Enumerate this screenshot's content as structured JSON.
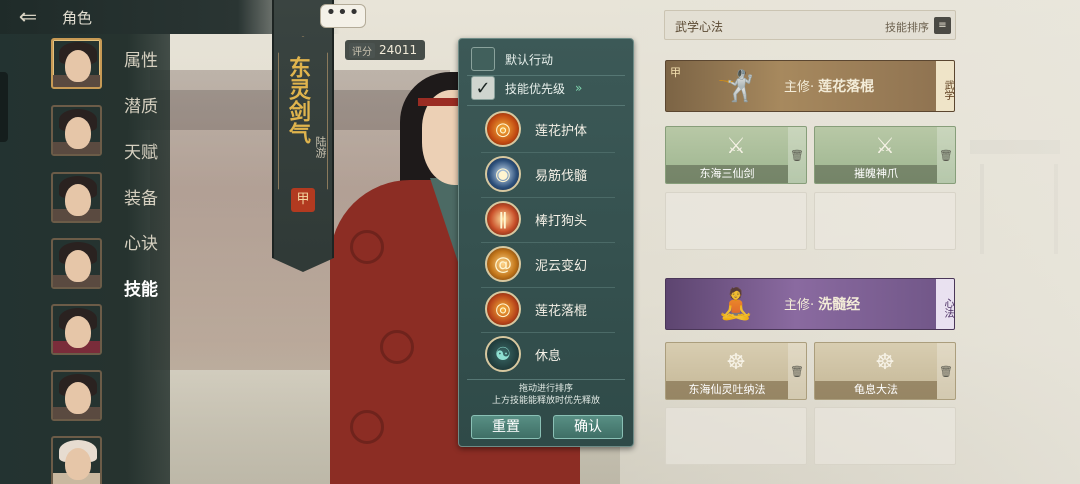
{
  "header": {
    "title": "角色"
  },
  "nav": {
    "items": [
      {
        "label": "属性",
        "active": false
      },
      {
        "label": "潜质",
        "active": false
      },
      {
        "label": "天赋",
        "active": false
      },
      {
        "label": "装备",
        "active": false
      },
      {
        "label": "心诀",
        "active": false
      },
      {
        "label": "技能",
        "active": true
      }
    ]
  },
  "banner": {
    "school": "东灵剑气",
    "name": "陆游",
    "seal": "甲"
  },
  "score": {
    "label": "评分",
    "value": "24011"
  },
  "chat": {
    "icon": "•••"
  },
  "popup": {
    "default_action": {
      "label": "默认行动",
      "checked": false
    },
    "skill_priority": {
      "label": "技能优先级",
      "checked": true,
      "arrow": "»"
    },
    "skills": [
      {
        "name": "莲花护体",
        "icon": "fire-swirl-icon",
        "color": "#c24a12"
      },
      {
        "name": "易筋伐髓",
        "icon": "water-swirl-icon",
        "color": "#2c4f7a"
      },
      {
        "name": "棒打狗头",
        "icon": "staff-strike-icon",
        "color": "#c9502a"
      },
      {
        "name": "泥云变幻",
        "icon": "cloud-swirl-icon",
        "color": "#c4781c"
      },
      {
        "name": "莲花落棍",
        "icon": "fire-swirl-icon",
        "color": "#b8451a"
      },
      {
        "name": "休息",
        "icon": "meditation-icon",
        "color": "#1f3a3a"
      }
    ],
    "hint_line1": "拖动进行排序",
    "hint_line2": "上方技能能释放时优先释放",
    "reset_label": "重置",
    "confirm_label": "确认"
  },
  "right_panel": {
    "title": "武学心法",
    "sort_label": "技能排序",
    "sort_icon": "≡",
    "martial": {
      "grade": "甲",
      "prefix": "主修·",
      "name": "莲花落棍",
      "tag": "武学",
      "subs": [
        {
          "name": "东海三仙剑"
        },
        {
          "name": "摧魄神爪"
        }
      ]
    },
    "inner": {
      "prefix": "主修·",
      "name": "洗髓经",
      "tag": "心法",
      "subs": [
        {
          "name": "东海仙灵吐纳法"
        },
        {
          "name": "龟息大法"
        }
      ]
    },
    "trash_icon": "🗑"
  }
}
